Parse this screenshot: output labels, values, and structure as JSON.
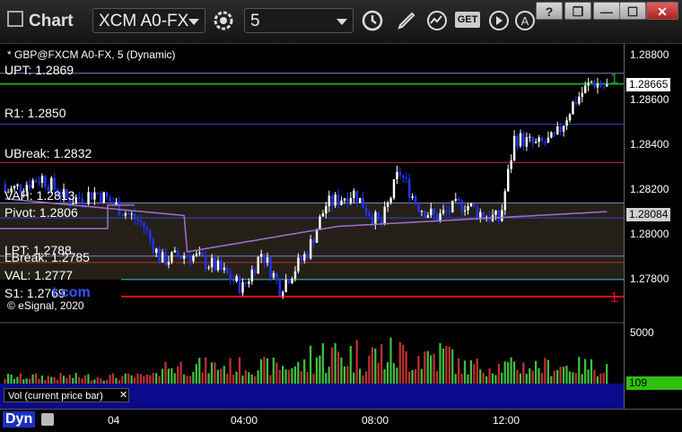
{
  "window": {
    "title": "Chart",
    "symbol": "XCM A0-FX",
    "interval": "5",
    "help_btn": "?",
    "restore_btn": "❐",
    "minimize_btn": "—",
    "maximize_btn": "☐",
    "close_btn": "✕"
  },
  "toolbar_icons": [
    "settings-icon",
    "clock-icon",
    "pen-icon",
    "chart-style-icon",
    "get-icon",
    "play-icon",
    "alert-icon"
  ],
  "get_label": "GET",
  "chart_header": "* GBP@FXCM A0-FX, 5 (Dynamic)",
  "watermark": "© eSignal, 2020",
  "levels": {
    "upt": "UPT: 1.2869",
    "r1": "R1: 1.2850",
    "ubreak": "UBreak: 1.2832",
    "vah": "VAH: 1.2813",
    "pivot": "Pivot: 1.2806",
    "lbreak": "LBreak: 1.2785",
    "lpt": "LPT: 1.2788",
    "val": "VAL: 1.2777",
    "s1": "S1: 1.2769",
    "s1_overlay": "t.com"
  },
  "markers": {
    "top": "1",
    "bottom": "1"
  },
  "price_axis": [
    "1.28800",
    "1.28600",
    "1.28400",
    "1.28200",
    "1.28000",
    "1.27800"
  ],
  "price_tags": {
    "last": "1.28665",
    "ma": "1.28084"
  },
  "volume": {
    "label": "Vol (current price bar)",
    "close_x": "✕",
    "axis_tick": "5000",
    "last_value": "109"
  },
  "time_axis": [
    "04",
    "04:00",
    "08:00",
    "12:00"
  ],
  "bottom_left": "Dyn",
  "colors": {
    "up": "#ffffff",
    "down": "#2233ff",
    "ma": "#a070d0",
    "green": "#18a018",
    "red": "#e01010",
    "blue_line": "#3344cc",
    "cyan": "#40c0c0",
    "purple_line": "#8080c0"
  },
  "chart_data": {
    "type": "candlestick",
    "ylim": [
      1.2766,
      1.2884
    ],
    "ohlc_start": 1.2822,
    "bars": 196
  }
}
